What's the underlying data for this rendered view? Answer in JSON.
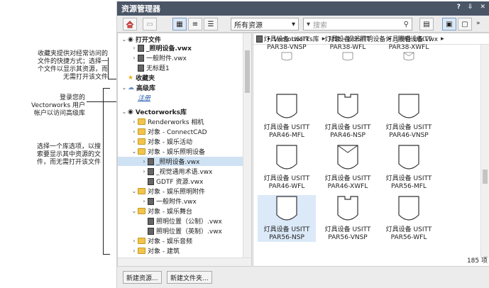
{
  "notes": {
    "favorites": [
      "收藏夹提供对经常访问的",
      "文件的快捷方式；选择一",
      "个文件以显示其资源，而",
      "无需打开该文件"
    ],
    "login": [
      "登录您的",
      "Vectorworks 用户",
      "帐户以访问高级库"
    ],
    "library": [
      "选择一个库选项，以搜",
      "索要显示其中资源的文",
      "件，而无需打开该文件"
    ]
  },
  "panel": {
    "title": "资源管理器",
    "title_buttons": [
      "?",
      "⇩",
      "✕"
    ]
  },
  "toolbar": {
    "filter_value": "所有资源",
    "search_placeholder": "搜索"
  },
  "tree": [
    {
      "label": "打开文件",
      "icon": "open-file-icon",
      "kind": "section",
      "twisty": "⌄"
    },
    {
      "label": "_照明设备.vwx",
      "icon": "file-icon",
      "kind": "bold",
      "twisty": "›"
    },
    {
      "label": "一般附件.vwx",
      "icon": "file-icon",
      "kind": "item",
      "twisty": "›"
    },
    {
      "label": "无标题1",
      "icon": "file-icon",
      "kind": "item",
      "twisty": ""
    },
    {
      "label": "收藏夹",
      "icon": "star-icon",
      "kind": "section",
      "twisty": ""
    },
    {
      "label": "高级库",
      "icon": "cloud-icon",
      "kind": "section",
      "twisty": "⌄"
    },
    {
      "label": "注册",
      "icon": "",
      "kind": "link",
      "twisty": ""
    },
    {
      "label": "Vectorworks库",
      "icon": "library-icon",
      "kind": "section",
      "twisty": "⌄"
    },
    {
      "label": "Renderworks 相机",
      "icon": "folder-icon",
      "kind": "item",
      "twisty": "›"
    },
    {
      "label": "对象 - ConnectCAD",
      "icon": "folder-icon",
      "kind": "item",
      "twisty": "›"
    },
    {
      "label": "对象 - 娱乐活动",
      "icon": "folder-icon",
      "kind": "item",
      "twisty": "›"
    },
    {
      "label": "对象 - 娱乐照明设备",
      "icon": "folder-icon",
      "kind": "item",
      "twisty": "⌄"
    },
    {
      "label": "_照明设备.vwx",
      "icon": "file-icon",
      "kind": "selected",
      "twisty": "›"
    },
    {
      "label": "_视觉通用术语.vwx",
      "icon": "file-icon",
      "kind": "item",
      "twisty": "›"
    },
    {
      "label": "GDTF 资源.vwx",
      "icon": "file-icon",
      "kind": "item",
      "twisty": ""
    },
    {
      "label": "对象 - 娱乐照明附件",
      "icon": "folder-icon",
      "kind": "item",
      "twisty": "⌄"
    },
    {
      "label": "一般附件.vwx",
      "icon": "file-icon",
      "kind": "item",
      "twisty": "›"
    },
    {
      "label": "对象 - 娱乐舞台",
      "icon": "folder-icon",
      "kind": "item",
      "twisty": "⌄"
    },
    {
      "label": "照明位置（公制）.vwx",
      "icon": "file-icon",
      "kind": "item",
      "twisty": ""
    },
    {
      "label": "照明位置（英制）.vwx",
      "icon": "file-icon",
      "kind": "item",
      "twisty": ""
    },
    {
      "label": "对象 - 娱乐音频",
      "icon": "folder-icon",
      "kind": "item",
      "twisty": "›"
    },
    {
      "label": "对象 - 建筑",
      "icon": "folder-icon",
      "kind": "item",
      "twisty": "›"
    }
  ],
  "breadcrumb": [
    "Vectorworks库",
    "对象 - 娱乐照明设备",
    "_照明设备.vwx"
  ],
  "resources": [
    {
      "l1": "灯具设备 USITT",
      "l2": "PAR38-VNSP",
      "shape": "notch"
    },
    {
      "l1": "灯具设备 USITT",
      "l2": "PAR38-WFL",
      "shape": "plain"
    },
    {
      "l1": "灯具设备 USITT",
      "l2": "PAR38-XWFL",
      "shape": "x"
    },
    {
      "l1": "灯具设备 USITT",
      "l2": "PAR46-MFL",
      "shape": "plain"
    },
    {
      "l1": "灯具设备 USITT",
      "l2": "PAR46-NSP",
      "shape": "notch"
    },
    {
      "l1": "灯具设备 USITT",
      "l2": "PAR46-VNSP",
      "shape": "plain"
    },
    {
      "l1": "灯具设备 USITT",
      "l2": "PAR46-WFL",
      "shape": "plain"
    },
    {
      "l1": "灯具设备 USITT",
      "l2": "PAR46-XWFL",
      "shape": "x"
    },
    {
      "l1": "灯具设备 USITT",
      "l2": "PAR56-MFL",
      "shape": "plain"
    },
    {
      "l1": "灯具设备 USITT",
      "l2": "PAR56-NSP",
      "shape": "plain"
    },
    {
      "l1": "灯具设备 USITT",
      "l2": "PAR56-VNSP",
      "shape": "notch"
    },
    {
      "l1": "灯具设备 USITT",
      "l2": "PAR56-WFL",
      "shape": "plain"
    }
  ],
  "status": {
    "count": "185 项"
  },
  "buttons": {
    "new_resource": "新建资源...",
    "new_file": "新建文件夹..."
  }
}
